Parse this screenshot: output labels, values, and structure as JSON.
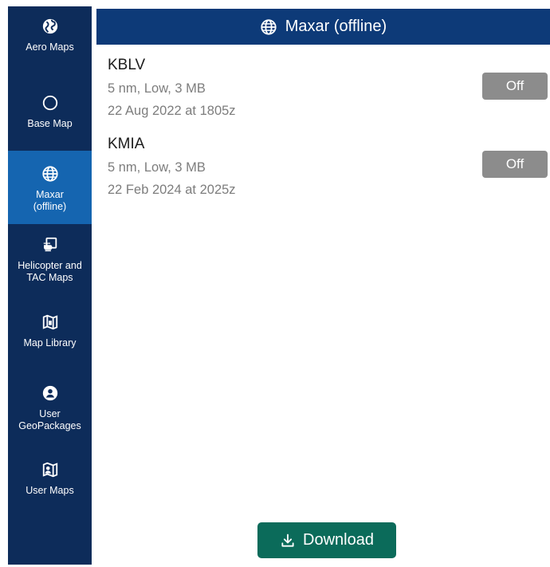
{
  "sidebar": {
    "items": [
      {
        "label": "Aero Maps",
        "icon": "globe-filled-icon",
        "active": false
      },
      {
        "label": "Base Map",
        "icon": "circle-outline-icon",
        "active": false
      },
      {
        "label": "Maxar\n(offline)",
        "icon": "globe-grid-icon",
        "active": true
      },
      {
        "label": "Helicopter and\nTAC Maps",
        "icon": "helicopter-map-icon",
        "active": false
      },
      {
        "label": "Map Library",
        "icon": "map-library-icon",
        "active": false
      },
      {
        "label": "User\nGeoPackages",
        "icon": "user-geopackage-icon",
        "active": false
      },
      {
        "label": "User Maps",
        "icon": "user-map-icon",
        "active": false
      }
    ]
  },
  "header": {
    "title": "Maxar (offline)",
    "icon": "globe-grid-icon"
  },
  "maps": [
    {
      "name": "KBLV",
      "detail": "5 nm, Low, 3 MB",
      "date": "22 Aug 2022 at 1805z",
      "toggle": "Off"
    },
    {
      "name": "KMIA",
      "detail": "5 nm, Low, 3 MB",
      "date": "22 Feb 2024 at 2025z",
      "toggle": "Off"
    }
  ],
  "download": {
    "label": "Download",
    "icon": "download-icon"
  },
  "colors": {
    "sidebar_bg": "#0d2c5a",
    "sidebar_active": "#1565b0",
    "header_bg": "#0d3a78",
    "toggle_off": "#8c8c8c",
    "download_bg": "#0b6b5a"
  }
}
